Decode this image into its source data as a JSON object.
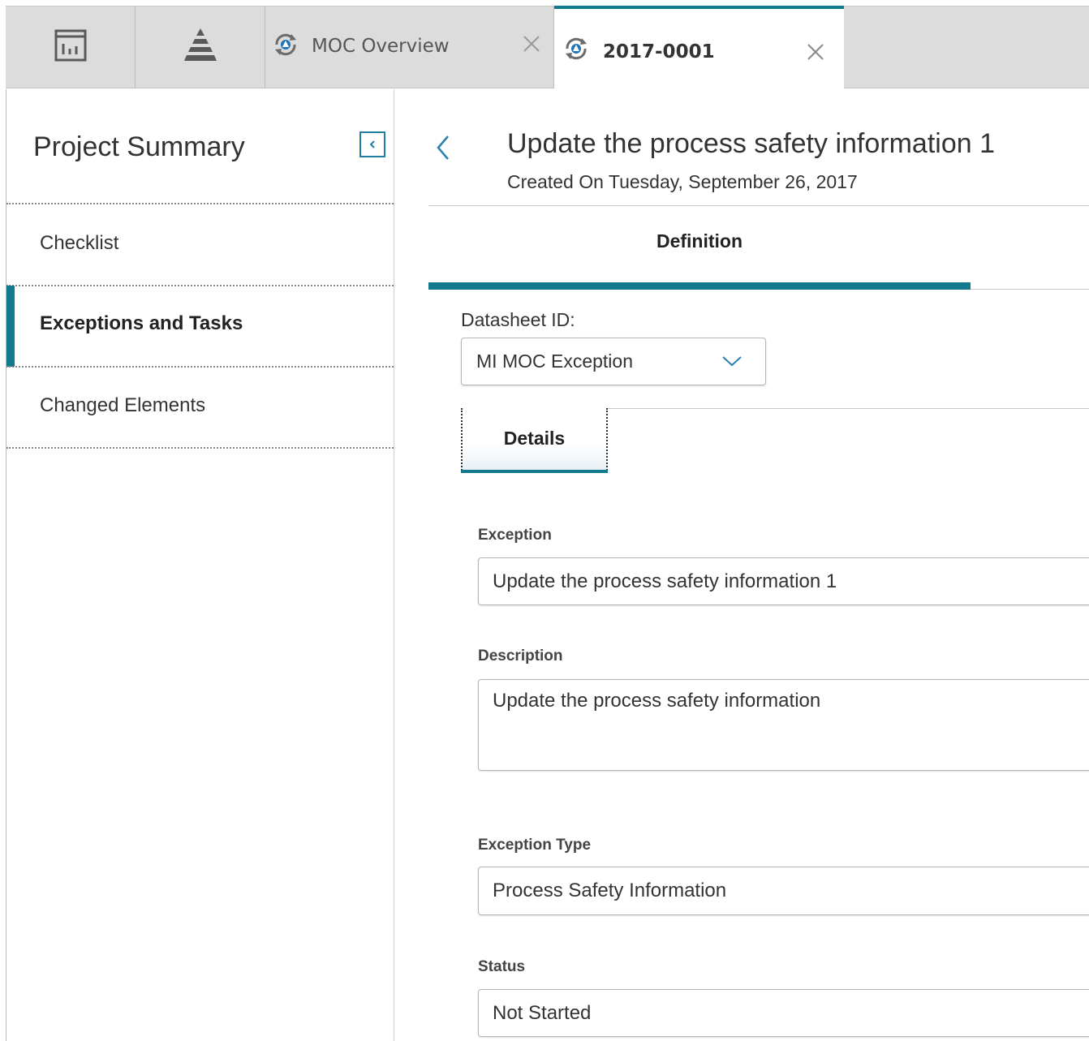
{
  "tabs": {
    "icon_tab_1": "dashboard-icon",
    "icon_tab_2": "pyramid-icon",
    "moc_tab": {
      "label": "MOC Overview",
      "icon": "moc-cycle-icon"
    },
    "active_tab": {
      "label": "2017-0001",
      "icon": "moc-cycle-icon"
    }
  },
  "sidebar": {
    "title": "Project Summary",
    "items": [
      {
        "label": "Checklist"
      },
      {
        "label": "Exceptions and Tasks"
      },
      {
        "label": "Changed Elements"
      }
    ]
  },
  "record": {
    "title": "Update the process safety information 1",
    "subtitle": "Created On Tuesday, September 26, 2017"
  },
  "definition_tab": {
    "label": "Definition"
  },
  "datasheet": {
    "label": "Datasheet ID:",
    "value": "MI MOC Exception"
  },
  "details_tab": {
    "label": "Details"
  },
  "fields": {
    "exception": {
      "label": "Exception",
      "value": "Update the process safety information 1"
    },
    "description": {
      "label": "Description",
      "value": "Update the process safety information"
    },
    "exception_type": {
      "label": "Exception Type",
      "value": "Process Safety Information"
    },
    "status": {
      "label": "Status",
      "value": "Not Started"
    }
  },
  "colors": {
    "accent": "#137a8e",
    "tab_bar": "#dcdcdc"
  }
}
